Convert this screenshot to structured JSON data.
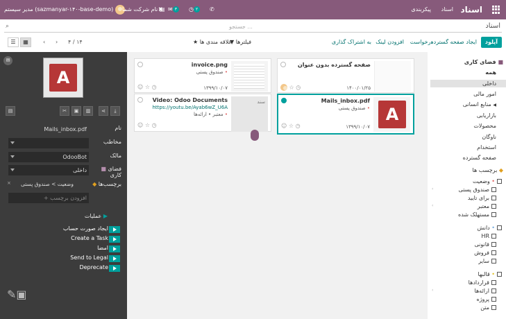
{
  "topbar": {
    "app_name": "اسناد",
    "menu": [
      "اسناد",
      "پیکربندی"
    ],
    "user": "مدیر سیستم (sazmanyar-۱۴۰-base-demo)",
    "company": "نام شرکت شما",
    "msg_count": "۳",
    "activity_count": "۲"
  },
  "search": {
    "placeholder": "جستجو ..."
  },
  "page": {
    "title": "اسناد"
  },
  "control": {
    "upload": "آپلود",
    "create_page": "ایجاد صفحه گسترده",
    "request": "درخواست",
    "add_link": "افزودن لینک",
    "share": "به اشتراک گذاری",
    "filters": "فیلترها",
    "favorites": "علاقه مندی ها",
    "pager": "۴ / ۱۴"
  },
  "inspector": {
    "fields": [
      {
        "label": "نام",
        "value": "Mails_inbox.pdf"
      },
      {
        "label": "مخاطب",
        "value": ""
      },
      {
        "label": "مالک",
        "value": "OdooBot"
      },
      {
        "label": "فضای کاری",
        "value": "داخلی"
      },
      {
        "label": "برچسب‌ها",
        "value": "وضعیت > صندوق پستی"
      }
    ],
    "tag_placeholder": "+ افزودن برچسب",
    "ops_title": "عملیات",
    "ops": [
      "ایجاد صورت حساب",
      "Create a Task",
      "امضا",
      "Send to Legal",
      "Deprecate"
    ]
  },
  "cards": [
    {
      "title": "صفحه گسترده بدون عنوان",
      "subtitle": "",
      "date": "۱۴۰۰/۰۱/۲۵",
      "selected": false
    },
    {
      "title": "invoice.png",
      "subtitle": "صندوق پستی",
      "date": "۱۳۹۹/۱۰/۰۷",
      "selected": false
    },
    {
      "title": "Mails_inbox.pdf",
      "subtitle": "صندوق پستی",
      "date": "۱۳۹۹/۱۰/۰۷",
      "selected": true
    },
    {
      "title": "Video: Odoo Documents",
      "subtitle": "https://youtu.be/Ayab6wZ_U6A",
      "subtitle2": "معتبر • ارائه‌ها",
      "date": "۱۳۹۹/۱۰/۰۷",
      "thumb_label": "سند",
      "selected": false
    }
  ],
  "sidebar": {
    "workspaces_title": "فضای کاری",
    "workspaces": [
      "همه",
      "داخلی",
      "امور مالی",
      "منابع انسانی",
      "بازاریابی",
      "محصولات",
      "ناوگان",
      "استخدام",
      "صفحه گسترده"
    ],
    "tags_title": "برچسب ها",
    "groups": [
      {
        "name": "وضعیت",
        "items": [
          "صندوق پستی",
          "برای تایید",
          "معتبر",
          "مستهلک شده"
        ]
      },
      {
        "name": "دانش",
        "items": [
          "HR",
          "قانونی",
          "فروش",
          "سایر"
        ]
      },
      {
        "name": "قالبها",
        "items": [
          "قراردادها",
          "ارائه‌ها",
          "پروژه",
          "متن"
        ]
      }
    ]
  },
  "colors": {
    "brand": "#875a7b",
    "accent": "#00a09d",
    "panel": "#3c3c3c"
  }
}
